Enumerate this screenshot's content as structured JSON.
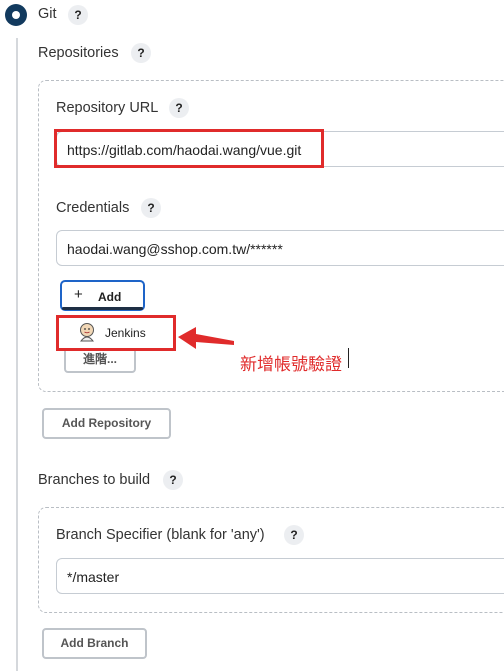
{
  "scm": {
    "option_label": "Git",
    "help": "?"
  },
  "repositories": {
    "label": "Repositories",
    "help": "?",
    "url_label": "Repository URL",
    "url_value": "https://gitlab.com/haodai.wang/vue.git",
    "credentials_label": "Credentials",
    "credentials_value": "haodai.wang@sshop.com.tw/******",
    "add_button": {
      "icon_glyph": "+",
      "label": "Add"
    },
    "dropdown": {
      "item_label": "Jenkins"
    },
    "advanced_label": "進階...",
    "add_repository_label": "Add Repository"
  },
  "branches": {
    "label": "Branches to build",
    "help": "?",
    "specifier_label": "Branch Specifier (blank for 'any')",
    "specifier_value": "*/master",
    "add_branch_label": "Add Branch"
  },
  "annotation": {
    "text": "新增帳號驗證"
  },
  "colors": {
    "accent": "#1e64c8",
    "highlight": "#e02b2b",
    "radio": "#123a5e"
  }
}
